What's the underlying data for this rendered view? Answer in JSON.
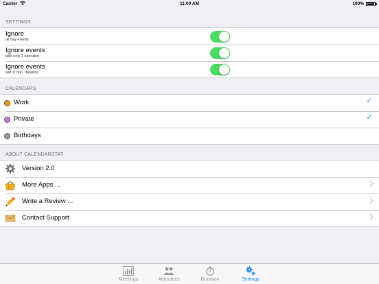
{
  "status_bar": {
    "carrier": "Carrier",
    "time": "11:00 AM",
    "battery": "100%"
  },
  "settings": {
    "header": "SETTINGS",
    "rows": [
      {
        "title": "Ignore",
        "subtitle": "all day events",
        "on": true
      },
      {
        "title": "Ignore events",
        "subtitle": "with only 1 attendee",
        "on": true
      },
      {
        "title": "Ignore events",
        "subtitle": "with 0 min. duration",
        "on": true
      }
    ]
  },
  "calendars": {
    "header": "CALENDARS",
    "rows": [
      {
        "label": "Work",
        "color": "#ff9500",
        "checked": true,
        "check": "✓"
      },
      {
        "label": "Private",
        "color": "#cc73e1",
        "checked": true,
        "check": "✓"
      },
      {
        "label": "Birthdays",
        "color": "#8e9aab",
        "checked": false,
        "check": ""
      }
    ]
  },
  "about": {
    "header": "ABOUT CALENDARSTAT",
    "rows": [
      {
        "label": "Version 2.0",
        "icon": "gear-icon",
        "chevron": false
      },
      {
        "label": "More Apps ...",
        "icon": "basket-icon",
        "chevron": true
      },
      {
        "label": "Write a Review ...",
        "icon": "pencil-icon",
        "chevron": true
      },
      {
        "label": "Contact Support",
        "icon": "envelope-icon",
        "chevron": true
      }
    ]
  },
  "tabbar": {
    "tabs": [
      {
        "label": "Meetings",
        "icon": "bar-chart-icon",
        "active": false
      },
      {
        "label": "Attendees",
        "icon": "people-icon",
        "active": false
      },
      {
        "label": "Duration",
        "icon": "stopwatch-icon",
        "active": false
      },
      {
        "label": "Settings",
        "icon": "gears-icon",
        "active": true
      }
    ],
    "accent": "#1a82fb"
  }
}
